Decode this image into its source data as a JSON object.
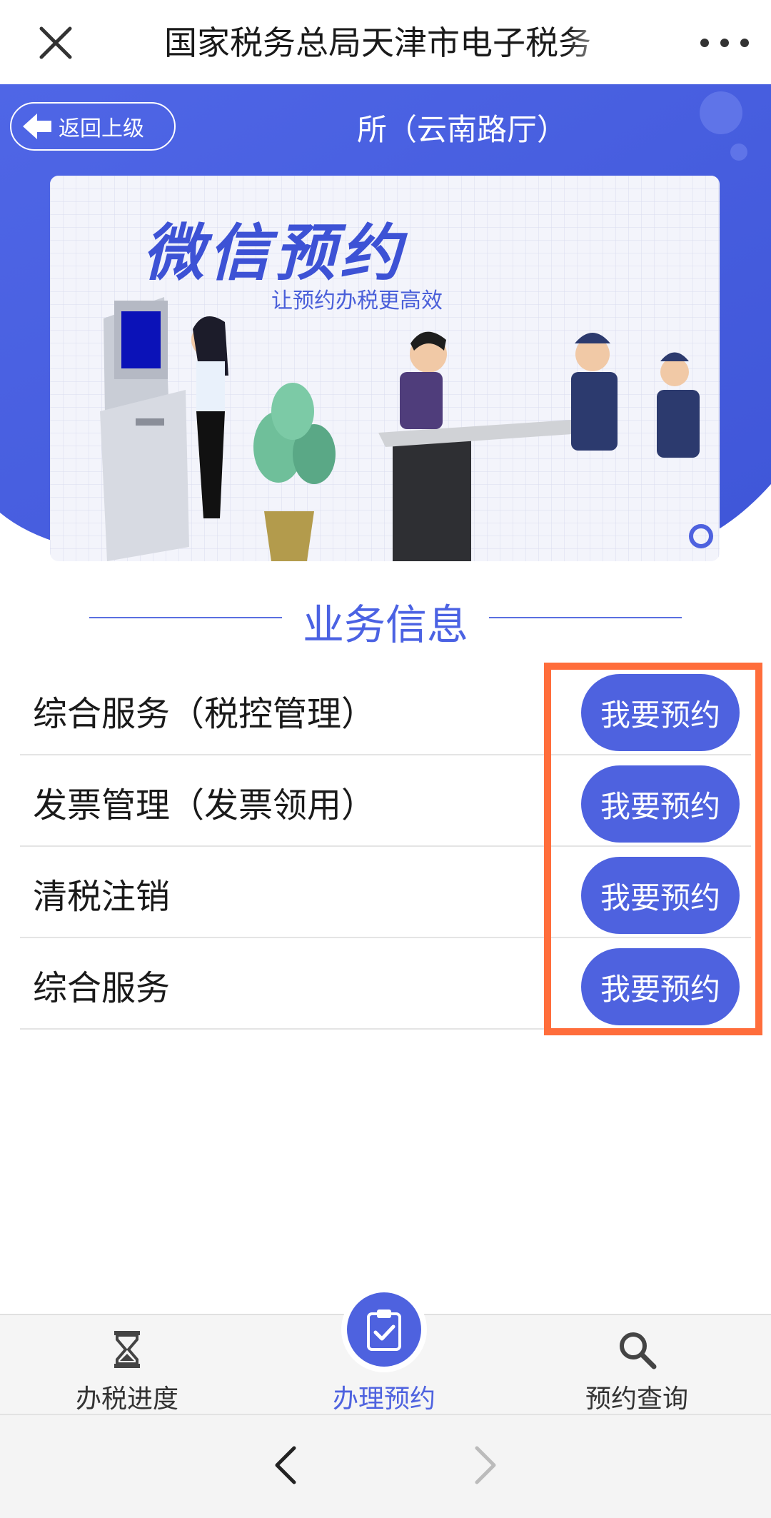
{
  "topbar": {
    "title": "国家税务总局天津市电子税务",
    "close_icon": "close-icon",
    "more_icon": "more-icon"
  },
  "header": {
    "back_label": "返回上级",
    "page_title": "所（云南路厅）"
  },
  "banner": {
    "title": "微信预约",
    "subtitle": "让预约办税更高效"
  },
  "section": {
    "title": "业务信息"
  },
  "services": [
    {
      "name": "综合服务（税控管理）",
      "button": "我要预约"
    },
    {
      "name": "发票管理（发票领用）",
      "button": "我要预约"
    },
    {
      "name": "清税注销",
      "button": "我要预约"
    },
    {
      "name": "综合服务",
      "button": "我要预约"
    }
  ],
  "tabs": [
    {
      "label": "办税进度",
      "icon": "hourglass-icon"
    },
    {
      "label": "办理预约",
      "icon": "clipboard-check-icon"
    },
    {
      "label": "预约查询",
      "icon": "search-icon"
    }
  ],
  "colors": {
    "accent": "#4e62df",
    "highlight": "#ff6d3b"
  }
}
